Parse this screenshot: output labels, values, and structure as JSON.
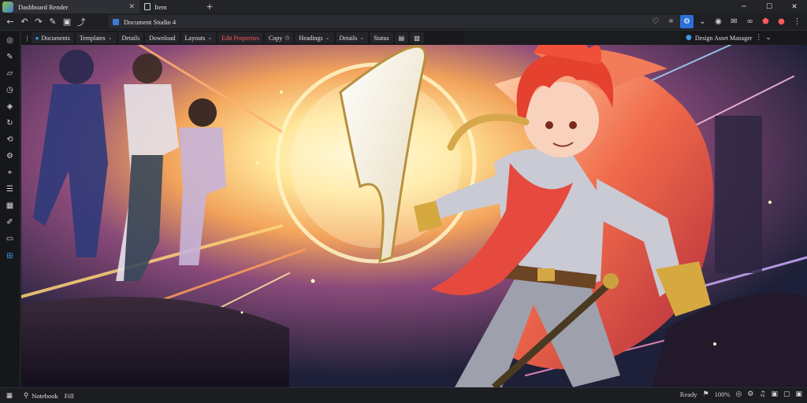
{
  "window": {
    "tabs": [
      {
        "title": "Dashboard Render",
        "active": true
      },
      {
        "title": "Item",
        "active": false
      }
    ],
    "new_tab": "+",
    "controls": {
      "minimize": "─",
      "maximize": "☐",
      "close": "✕"
    }
  },
  "address_bar": {
    "url": "Document Studio 4"
  },
  "toolbar": {
    "items": [
      {
        "label": "Documents"
      },
      {
        "label": "Templates"
      },
      {
        "label": "Details"
      },
      {
        "label": "Download"
      },
      {
        "label": "Layouts"
      },
      {
        "label": "Edit Properties"
      },
      {
        "label": "Copy"
      },
      {
        "label": "Headings"
      },
      {
        "label": "Details"
      },
      {
        "label": "Status"
      }
    ],
    "right_label": "Design Asset Manager"
  },
  "status_bar": {
    "left_items": [
      {
        "label": "Notebook"
      },
      {
        "label": "Fill"
      }
    ],
    "right_text": "Ready",
    "zoom": "100%"
  },
  "colors": {
    "accent": "#2b6fd6",
    "alert": "#ff5a5a",
    "hair": "#e4412e",
    "cape": "#d94a3b",
    "glow": "#fff3b0"
  }
}
